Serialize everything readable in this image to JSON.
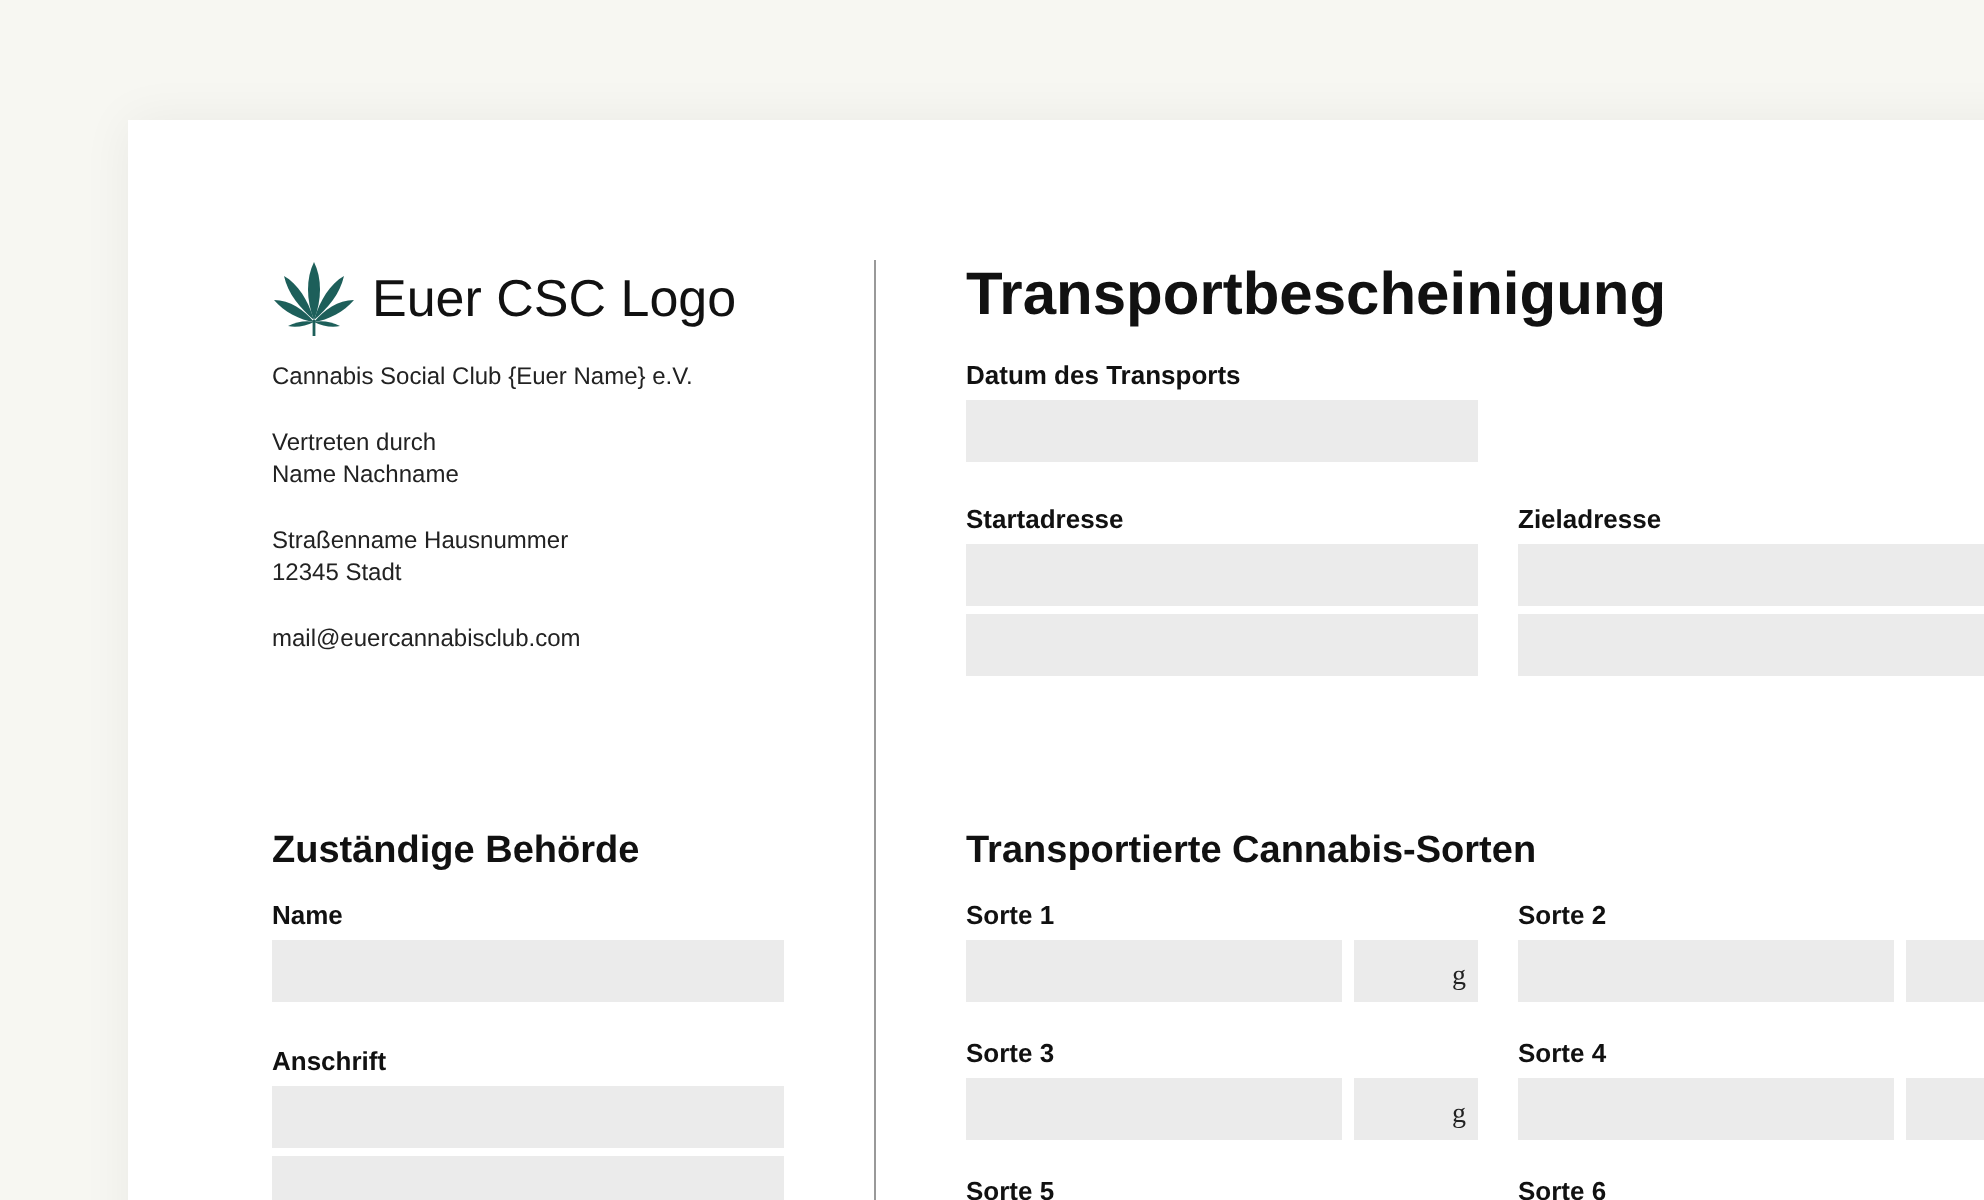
{
  "organization": {
    "logo_text": "Euer CSC Logo",
    "name": "Cannabis Social Club {Euer Name} e.V.",
    "blocks": [
      {
        "lines": [
          "Vertreten durch",
          "Name Nachname"
        ]
      },
      {
        "lines": [
          "Straßenname Hausnummer",
          "12345 Stadt"
        ]
      },
      {
        "lines": [
          "mail@euercannabisclub.com"
        ]
      }
    ]
  },
  "authority": {
    "heading": "Zuständige Behörde",
    "fields": [
      {
        "label": "Name",
        "kind": "single"
      },
      {
        "label": "Anschrift",
        "kind": "double"
      }
    ]
  },
  "certificate": {
    "title": "Transportbescheinigung",
    "date_field": {
      "label": "Datum des Transports",
      "kind": "single"
    },
    "address_fields": [
      {
        "label": "Startadresse",
        "kind": "double"
      },
      {
        "label": "Zieladresse",
        "kind": "double"
      }
    ]
  },
  "varieties": {
    "heading": "Transportierte Cannabis-Sorten",
    "items": [
      {
        "label": "Sorte 1",
        "unit": "g",
        "kind": "field"
      },
      {
        "label": "Sorte 2",
        "kind": "field"
      },
      {
        "label": "Sorte 3",
        "unit": "g",
        "kind": "field"
      },
      {
        "label": "Sorte 4",
        "kind": "field"
      },
      {
        "label": "Sorte 5",
        "kind": "label"
      },
      {
        "label": "Sorte 6",
        "kind": "label"
      }
    ]
  }
}
